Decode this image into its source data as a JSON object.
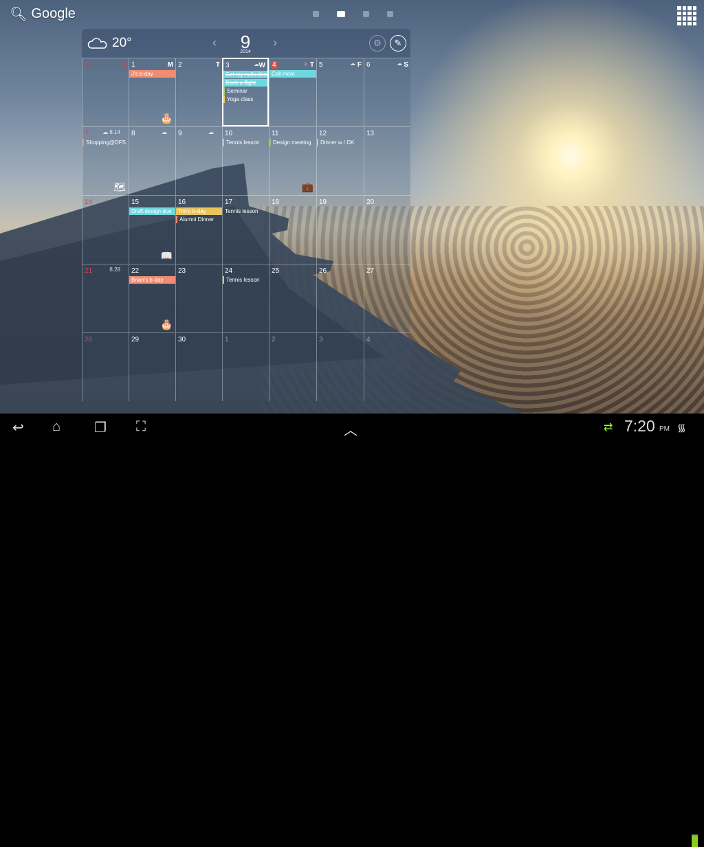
{
  "home": {
    "search_label": "Google",
    "pages": 4,
    "active_page": 2
  },
  "widget": {
    "weather_icon": "cloud-icon",
    "temperature": "20°",
    "month": "9",
    "year": "2014",
    "prev": "‹",
    "next": "›"
  },
  "colors": {
    "salmon": "#ef8c72",
    "cyan": "#6dd8e0",
    "yellow": "#e8c45a",
    "green": "#a8c060"
  },
  "weeks": [
    [
      {
        "d": "31",
        "w": "S",
        "red": true,
        "dim": true
      },
      {
        "d": "1",
        "w": "M",
        "ev": [
          {
            "t": "J's b-day",
            "s": "fill",
            "c": "salmon"
          }
        ],
        "icon": "🎂",
        "iconName": "birthday-cake-icon"
      },
      {
        "d": "2",
        "w": "T"
      },
      {
        "d": "3",
        "w": "W",
        "wx": "☁",
        "today": true,
        "ev": [
          {
            "t": "Get my nails done",
            "s": "fill",
            "c": "cyan",
            "done": true
          },
          {
            "t": "Book a flight",
            "s": "fill",
            "c": "cyan",
            "done": true
          },
          {
            "t": "Seminar",
            "s": "bar",
            "c": "green"
          },
          {
            "t": "Yoga class",
            "s": "bar",
            "c": "yellow"
          }
        ]
      },
      {
        "d": "4",
        "w": "T",
        "wx": "☼",
        "redbox": true,
        "ev": [
          {
            "t": "Call mom",
            "s": "fill",
            "c": "cyan"
          }
        ]
      },
      {
        "d": "5",
        "w": "F",
        "wx": "☁"
      },
      {
        "d": "6",
        "w": "S",
        "wx": "☁"
      }
    ],
    [
      {
        "d": "7",
        "red": true,
        "wx": "☁ 8.14",
        "ev": [
          {
            "t": "Shopping@DFS",
            "s": "bar",
            "c": "salmon"
          }
        ],
        "icon": "🗺",
        "iconName": "map-icon"
      },
      {
        "d": "8",
        "wx": "☁"
      },
      {
        "d": "9",
        "wx": "☁"
      },
      {
        "d": "10",
        "ev": [
          {
            "t": "Tennis lesson",
            "s": "bar",
            "c": "yellow"
          }
        ]
      },
      {
        "d": "11",
        "ev": [
          {
            "t": "Design meeting",
            "s": "bar",
            "c": "green"
          }
        ],
        "icon": "💼",
        "iconName": "briefcase-icon"
      },
      {
        "d": "12",
        "ev": [
          {
            "t": "Dinner w / DK",
            "s": "bar",
            "c": "yellow"
          }
        ]
      },
      {
        "d": "13"
      }
    ],
    [
      {
        "d": "14",
        "red": true
      },
      {
        "d": "15",
        "ev": [
          {
            "t": "Draft design due",
            "s": "fill",
            "c": "cyan"
          }
        ],
        "icon": "📖",
        "iconName": "book-icon"
      },
      {
        "d": "16",
        "ev": [
          {
            "t": "Tim's b-day",
            "s": "fill",
            "c": "yellow"
          },
          {
            "t": "Alumni Dinner",
            "s": "bar",
            "c": "salmon"
          }
        ]
      },
      {
        "d": "17",
        "ev": [
          {
            "t": "Tennis lesson",
            "s": "plain",
            "c": "yellow"
          }
        ]
      },
      {
        "d": "18"
      },
      {
        "d": "19"
      },
      {
        "d": "20"
      }
    ],
    [
      {
        "d": "21",
        "red": true,
        "wx": "8.28"
      },
      {
        "d": "22",
        "ev": [
          {
            "t": "Brian's b-day",
            "s": "fill",
            "c": "salmon"
          }
        ],
        "icon": "🎂",
        "iconName": "birthday-cake-icon"
      },
      {
        "d": "23"
      },
      {
        "d": "24",
        "ev": [
          {
            "t": "Tennis lesson",
            "s": "bar",
            "c": "yellow"
          }
        ]
      },
      {
        "d": "25"
      },
      {
        "d": "26"
      },
      {
        "d": "27"
      }
    ],
    [
      {
        "d": "28",
        "red": true
      },
      {
        "d": "29"
      },
      {
        "d": "30"
      },
      {
        "d": "1",
        "dim": true
      },
      {
        "d": "2",
        "dim": true
      },
      {
        "d": "3",
        "dim": true
      },
      {
        "d": "4",
        "dim": true
      }
    ]
  ],
  "statusbar": {
    "time": "7:20",
    "ampm": "PM"
  }
}
